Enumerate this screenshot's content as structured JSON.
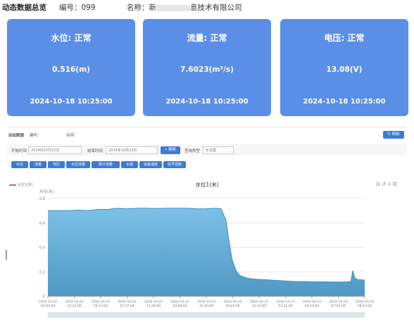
{
  "header": {
    "title": "动态数据总览",
    "code_label": "编号：099",
    "name_label": "名称：新",
    "name_suffix": "息技术有限公司"
  },
  "cards": [
    {
      "title": "水位:  正常",
      "value": "0.516(m)",
      "datetime": "2024-10-18 10:25:00"
    },
    {
      "title": "流量:  正常",
      "value": "7.6023(m³/s)",
      "datetime": "2024-10-18 10:25:00"
    },
    {
      "title": "电压:  正常",
      "value": "13.08(V)",
      "datetime": "2024-10-18 10:25:00"
    }
  ],
  "panel": {
    "breadcrumb": "动态数据",
    "field_code": "编号：",
    "field_name": "名称：",
    "refresh_label": "刷新",
    "start_label": "开始时间",
    "start_value": "2024年10月22日",
    "end_label": "结束时间",
    "end_value": "2024年10月23日",
    "query_label": "搜索",
    "type_label": "查询类型",
    "type_value": "水位图"
  },
  "chips": [
    "水位",
    "流量",
    "电压",
    "水位流量",
    "累计流量",
    "水温",
    "设备温度",
    "信号强度"
  ],
  "chart_data": {
    "type": "area",
    "title": "水位1(米)",
    "legend": "水位1(米)",
    "ylabel": "水位(米)",
    "ylim": [
      0,
      0.8
    ],
    "yticks": [
      0.8,
      0.6,
      0.4,
      0.2,
      0
    ],
    "color": "#6fb4dc",
    "x_ticks": [
      [
        "2024-10-22",
        "02:00:00"
      ],
      [
        "2024-10-22",
        "22:22:00"
      ],
      [
        "2024-10-22",
        "20:13:00"
      ],
      [
        "2024-10-22",
        "07:12:00"
      ],
      [
        "2024-10-22",
        "13:20:00"
      ],
      [
        "2024-10-22",
        "10:08:00"
      ],
      [
        "2024-10-22",
        "15:40:00"
      ],
      [
        "2024-10-22",
        "20:45:00"
      ],
      [
        "2024-10-23",
        "23:11:00"
      ],
      [
        "2024-10-23",
        "03:52:00"
      ],
      [
        "2024-10-23",
        "04:24:00"
      ],
      [
        "2024-10-23",
        "07:02:00"
      ],
      [
        "2024-10-23",
        "08:13:00"
      ]
    ],
    "points": [
      [
        0,
        0.7
      ],
      [
        1,
        0.7
      ],
      [
        2,
        0.7
      ],
      [
        3,
        0.705
      ],
      [
        4,
        0.7
      ],
      [
        5,
        0.71
      ],
      [
        6,
        0.71
      ],
      [
        7,
        0.72
      ],
      [
        8,
        0.715
      ],
      [
        9,
        0.72
      ],
      [
        10,
        0.72
      ],
      [
        11,
        0.718
      ],
      [
        12,
        0.72
      ],
      [
        13,
        0.72
      ],
      [
        14,
        0.72
      ],
      [
        15,
        0.715
      ],
      [
        16,
        0.716
      ],
      [
        17,
        0.72
      ],
      [
        17.5,
        0.715
      ],
      [
        18,
        0.62
      ],
      [
        18.3,
        0.45
      ],
      [
        18.6,
        0.3
      ],
      [
        19,
        0.21
      ],
      [
        19.4,
        0.17
      ],
      [
        20,
        0.15
      ],
      [
        20.6,
        0.142
      ],
      [
        21,
        0.14
      ],
      [
        22,
        0.135
      ],
      [
        23,
        0.13
      ],
      [
        24,
        0.125
      ],
      [
        25,
        0.12
      ],
      [
        26,
        0.12
      ],
      [
        27,
        0.118
      ],
      [
        28,
        0.118
      ],
      [
        29,
        0.117
      ],
      [
        30,
        0.117
      ],
      [
        30.6,
        0.12
      ],
      [
        30.8,
        0.21
      ],
      [
        31.0,
        0.15
      ],
      [
        31.3,
        0.135
      ],
      [
        31.6,
        0.135
      ],
      [
        32,
        0.132
      ]
    ],
    "x_max": 32
  }
}
